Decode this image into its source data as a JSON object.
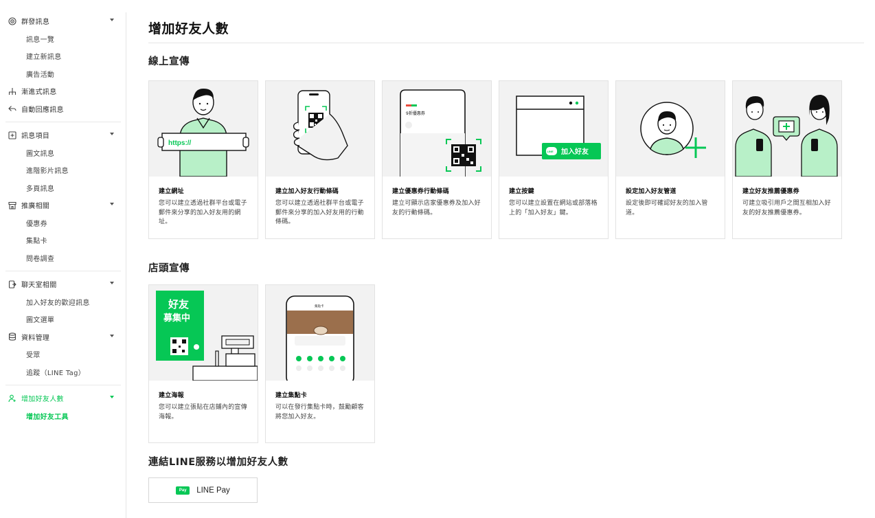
{
  "sidebar": {
    "groups": [
      {
        "label": "群發訊息",
        "icon": "broadcast-icon",
        "items": [
          "訊息一覽",
          "建立新訊息",
          "廣告活動"
        ]
      },
      {
        "label": "漸進式訊息",
        "icon": "flow-icon",
        "items": []
      },
      {
        "label": "自動回應訊息",
        "icon": "auto-reply-icon",
        "items": []
      },
      {
        "label": "訊息項目",
        "icon": "add-box-icon",
        "items": [
          "圖文訊息",
          "進階影片訊息",
          "多頁訊息"
        ]
      },
      {
        "label": "推廣相關",
        "icon": "store-icon",
        "items": [
          "優惠券",
          "集點卡",
          "問卷調查"
        ]
      },
      {
        "label": "聊天室相關",
        "icon": "chat-icon",
        "items": [
          "加入好友的歡迎訊息",
          "圖文選單"
        ]
      },
      {
        "label": "資料管理",
        "icon": "database-icon",
        "items": [
          "受眾",
          "追蹤（LINE Tag）"
        ]
      },
      {
        "label": "增加好友人數",
        "icon": "add-friend-icon",
        "items": [
          "增加好友工具"
        ]
      }
    ]
  },
  "main": {
    "title": "增加好友人數",
    "sections": {
      "online": "線上宣傳",
      "store": "店頭宣傳",
      "services": "連結LINE服務以增加好友人數"
    },
    "online_cards": [
      {
        "title": "建立網址",
        "desc": "您可以建立透過社群平台或電子郵件來分享的加入好友用的網址。"
      },
      {
        "title": "建立加入好友行動條碼",
        "desc": "您可以建立透過社群平台或電子郵件來分享的加入好友用的行動條碼。"
      },
      {
        "title": "建立優惠券行動條碼",
        "desc": "建立可顯示店家優惠券及加入好友的行動條碼。"
      },
      {
        "title": "建立按鍵",
        "desc": "您可以建立設置在網站或部落格上的「加入好友」鍵。"
      },
      {
        "title": "設定加入好友管道",
        "desc": "設定後即可確認好友的加入管道。"
      },
      {
        "title": "建立好友推薦優惠券",
        "desc": "可建立吸引用戶之間互相加入好友的好友推薦優惠券。"
      }
    ],
    "store_cards": [
      {
        "title": "建立海報",
        "desc": "您可以建立張貼在店鋪內的宣傳海報。"
      },
      {
        "title": "建立集點卡",
        "desc": "可以在發行集點卡時，鼓勵顧客將您加入好友。"
      }
    ],
    "art_text": {
      "url": "https://",
      "coupon": "9折優惠券",
      "add_friend_btn": "加入好友",
      "line_badge": "LINE",
      "poster_line1": "好友",
      "poster_line2": "募集中",
      "stamp_header": "集點卡"
    },
    "linepay": {
      "logo": "Pay",
      "label": "LINE Pay"
    }
  },
  "colors": {
    "accent": "#06c755",
    "art_bg": "#f2f2f2",
    "border": "#e2e2e2"
  }
}
